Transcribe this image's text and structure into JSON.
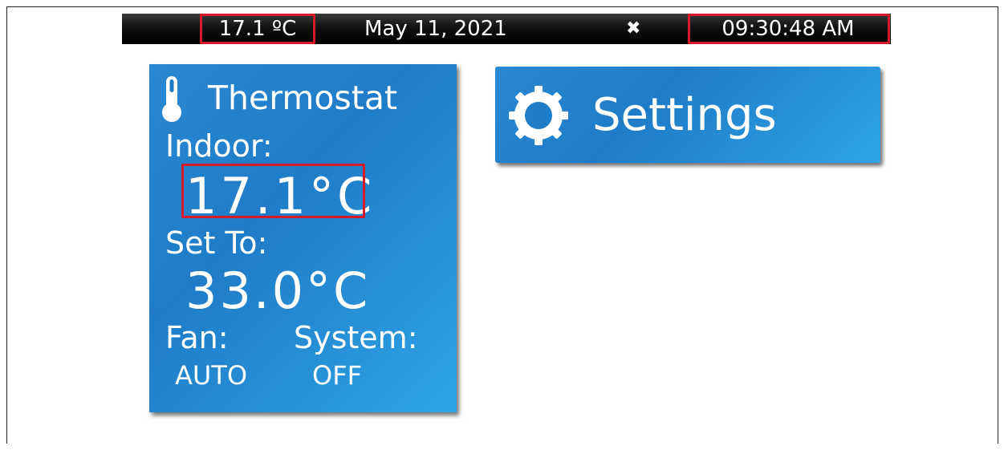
{
  "status_bar": {
    "temperature": "17.1 ºC",
    "date": "May 11, 2021",
    "fan_symbol": "✖",
    "time": "09:30:48 AM"
  },
  "thermostat": {
    "title": "Thermostat",
    "indoor_label": "Indoor:",
    "indoor_value": "17.1°C",
    "set_to_label": "Set To:",
    "set_to_value": "33.0°C",
    "fan_label": "Fan:",
    "fan_value": "AUTO",
    "system_label": "System:",
    "system_value": "OFF",
    "icon": "thermometer-icon"
  },
  "settings": {
    "label": "Settings",
    "icon": "gear-icon"
  },
  "colors": {
    "tile_blue": "#1f7cc8",
    "highlight_red": "#d61a2a",
    "status_bar_bg": "#000000"
  }
}
